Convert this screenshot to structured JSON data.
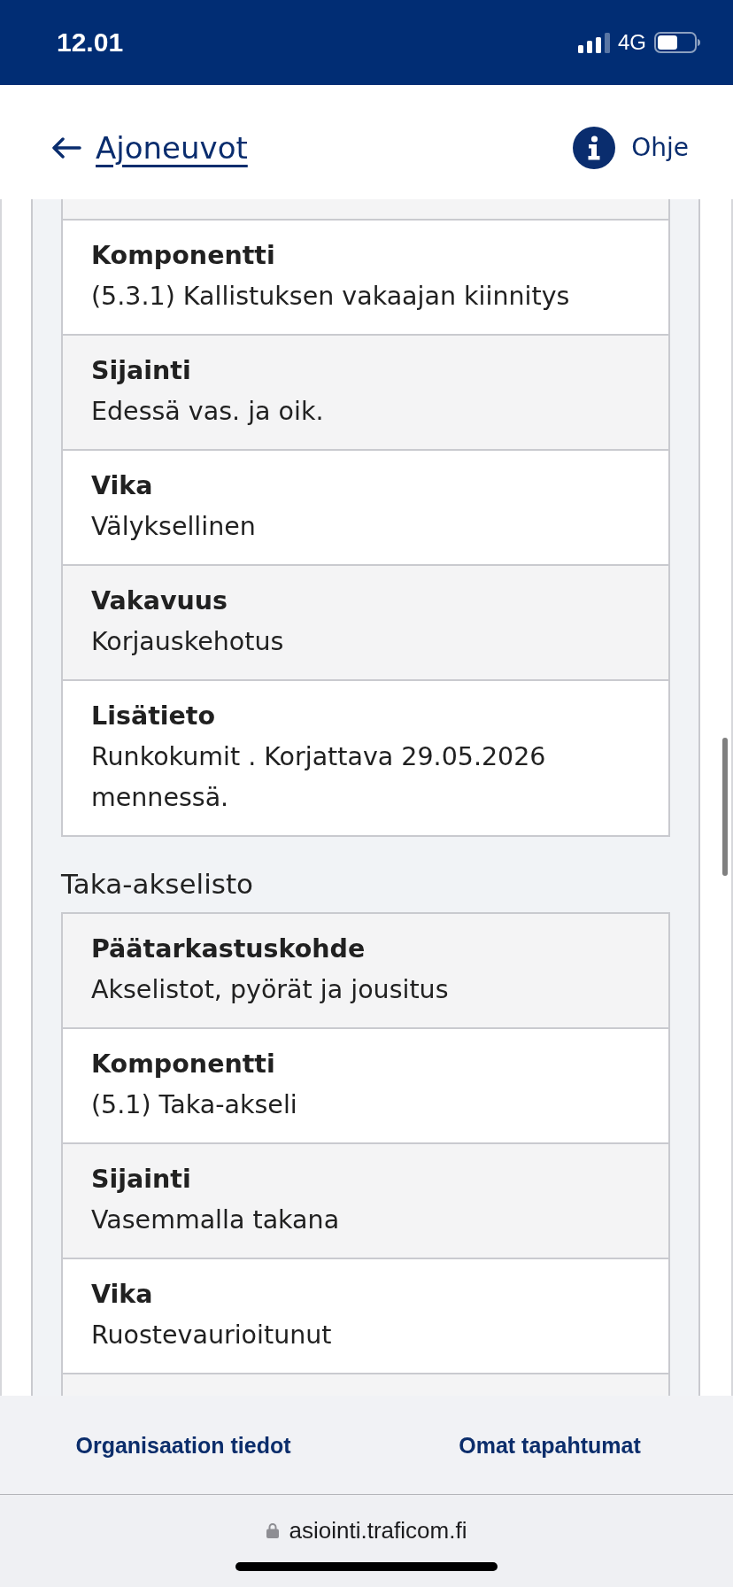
{
  "status_bar": {
    "time": "12.01",
    "network": "4G"
  },
  "header": {
    "back_link": "Ajoneuvot",
    "help_link": "Ohje"
  },
  "sections": [
    {
      "rows": [
        {
          "label": "Komponentti",
          "value": "(5.3.1) Kallistuksen vakaajan kiinnitys"
        },
        {
          "label": "Sijainti",
          "value": "Edessä vas. ja oik."
        },
        {
          "label": "Vika",
          "value": "Välyksellinen"
        },
        {
          "label": "Vakavuus",
          "value": "Korjauskehotus"
        },
        {
          "label": "Lisätieto",
          "value": "Runkokumit . Korjattava 29.05.2026 mennessä."
        }
      ]
    },
    {
      "title": "Taka-akselisto",
      "rows": [
        {
          "label": "Päätarkastuskohde",
          "value": "Akselistot, pyörät ja jousitus"
        },
        {
          "label": "Komponentti",
          "value": "(5.1) Taka-akseli"
        },
        {
          "label": "Sijainti",
          "value": "Vasemmalla takana"
        },
        {
          "label": "Vika",
          "value": "Ruostevaurioitunut"
        }
      ]
    }
  ],
  "bottom_nav": [
    "Organisaation tiedot",
    "Omat tapahtumat"
  ],
  "browser": {
    "url": "asiointi.traficom.fi"
  }
}
